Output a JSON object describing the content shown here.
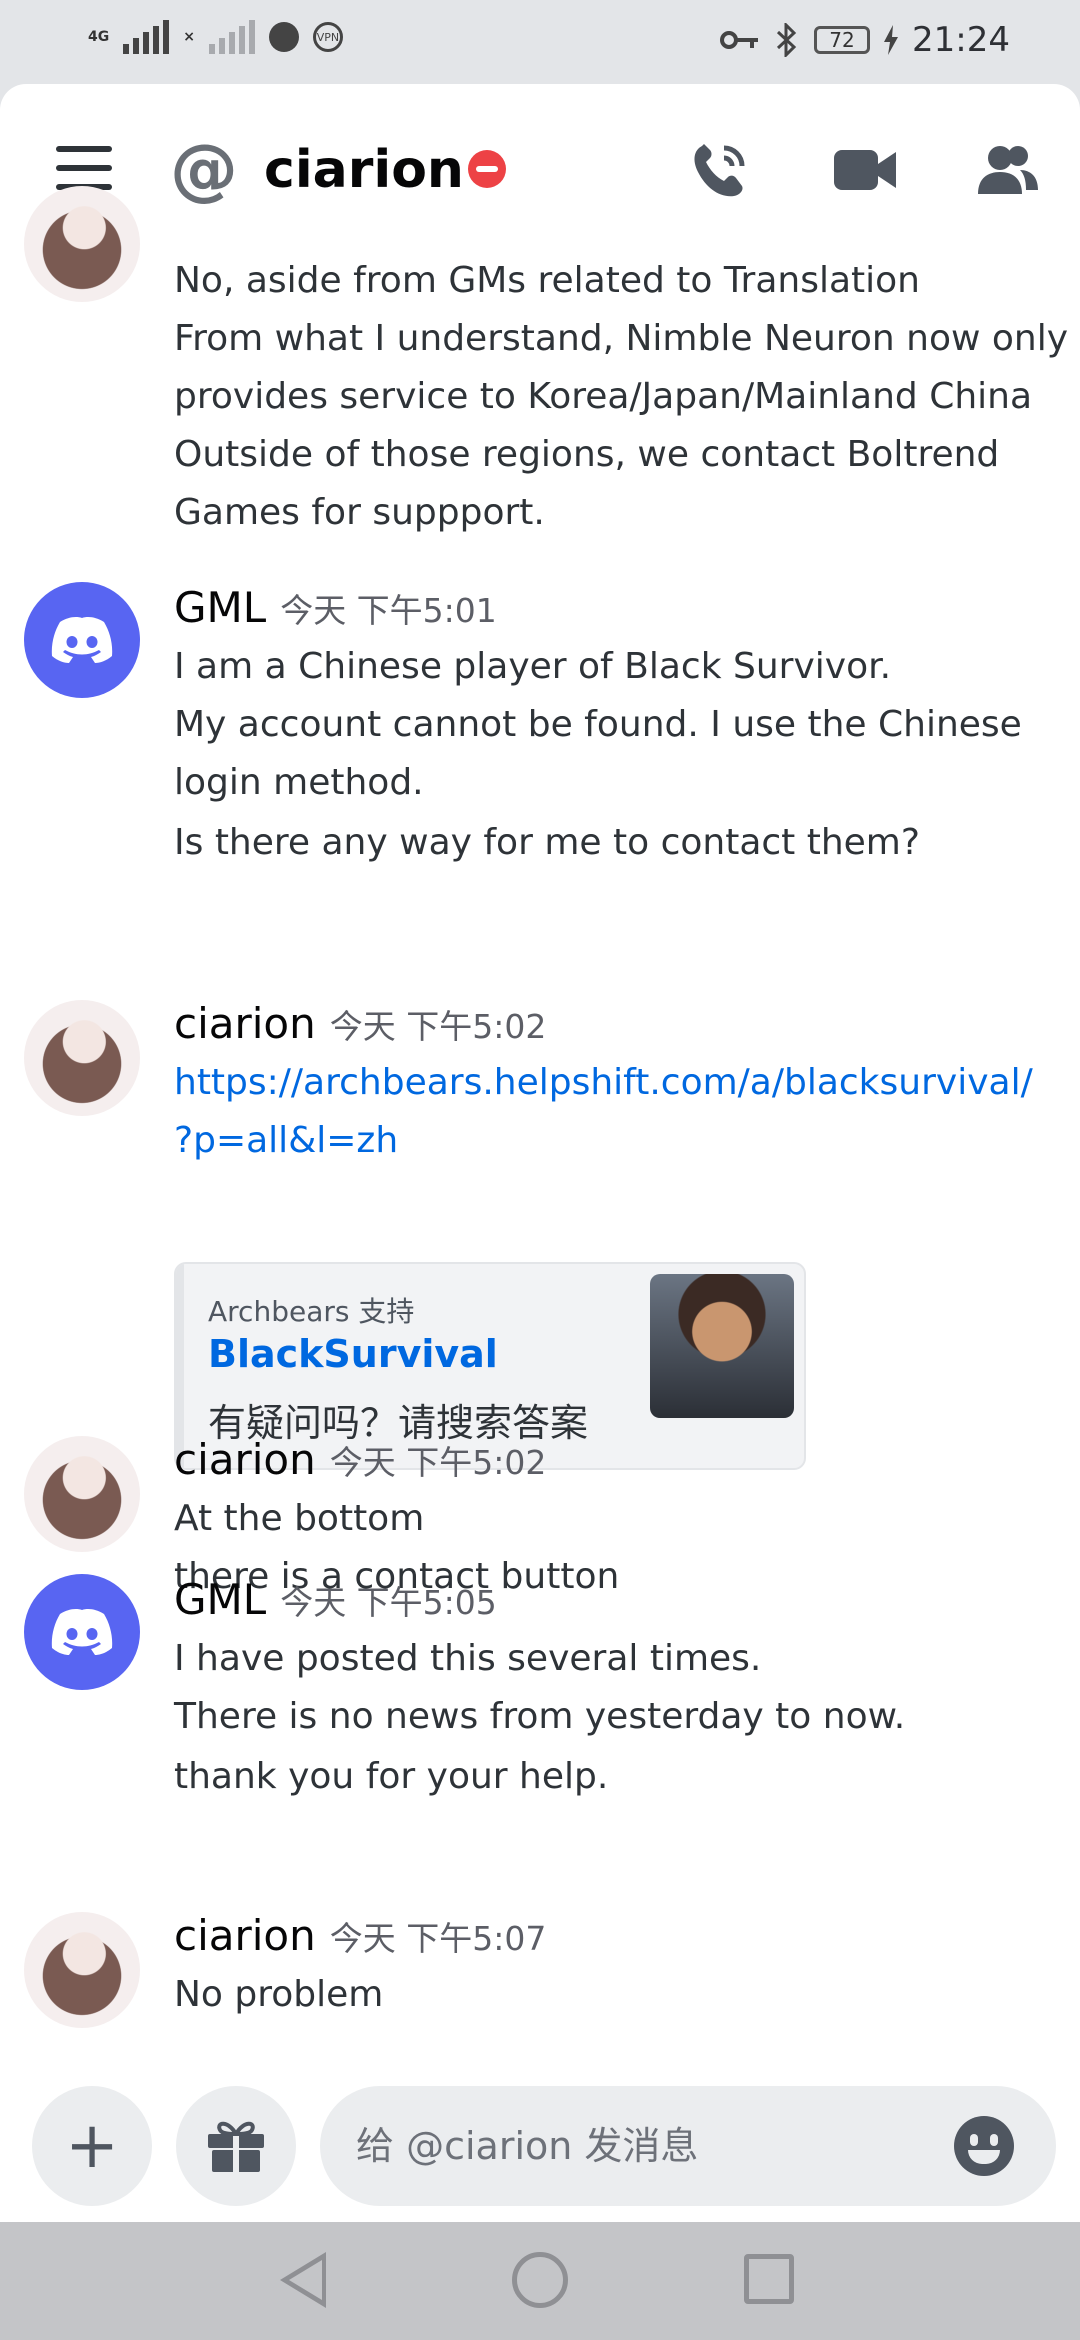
{
  "status_bar": {
    "time": "21:24",
    "battery": "72",
    "net1": "4G",
    "net2": "×",
    "vpn": "VPN"
  },
  "header": {
    "channel_name": "ciarion"
  },
  "messages": [
    {
      "lines": [
        "No, aside from GMs related to Translation",
        "From what I understand, Nimble Neuron now only",
        "provides service to Korea/Japan/Mainland China",
        "Outside of those regions, we contact Boltrend",
        "Games for suppport."
      ]
    },
    {
      "author": "GML",
      "timestamp": "今天 下午5:01",
      "lines": [
        "I am a Chinese player of Black Survivor.",
        "My account cannot be found. I use the Chinese",
        "login method.",
        "Is there any way for me to contact them?"
      ]
    },
    {
      "author": "ciarion",
      "timestamp": "今天 下午5:02",
      "link_lines": [
        "https://archbears.helpshift.com/a/blacksurvival/",
        "?p=all&l=zh"
      ],
      "embed": {
        "provider": "Archbears 支持",
        "title": "BlackSurvival",
        "description": "有疑问吗？请搜索答案"
      }
    },
    {
      "author": "ciarion",
      "timestamp": "今天 下午5:02",
      "lines": [
        "At the bottom",
        "there is a contact button"
      ]
    },
    {
      "author": "GML",
      "timestamp": "今天 下午5:05",
      "lines": [
        "I have posted this several times.",
        "There is no news from yesterday to now.",
        "thank you for your help."
      ]
    },
    {
      "author": "ciarion",
      "timestamp": "今天 下午5:07",
      "lines": [
        "No problem"
      ]
    }
  ],
  "composer": {
    "placeholder": "给 @ciarion 发消息"
  },
  "colors": {
    "blurple": "#5865f2",
    "link": "#0068e0",
    "dnd_red": "#ed4245",
    "panel_bg": "#ffffff",
    "chrome_bg": "#e3e5e8"
  }
}
